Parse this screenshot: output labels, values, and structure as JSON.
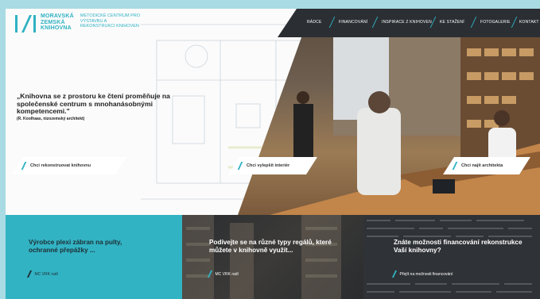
{
  "logo": {
    "name_lines": [
      "MORAVSKÁ",
      "ZEMSKÁ",
      "KNIHOVNA"
    ],
    "subtitle_lines": [
      "METODICKÉ CENTRUM PRO",
      "VÝSTAVBU A",
      "REKONSTRUKCI KNIHOVEN"
    ]
  },
  "nav": {
    "items": [
      "RÁDCE",
      "FINANCOVÁNÍ",
      "INSPIRACE Z KNIHOVEN",
      "KE STAŽENÍ",
      "FOTOGALERIE",
      "KONTAKT"
    ]
  },
  "hero": {
    "quote": "„Knihovna se z prostoru ke čtení proměňuje na společenské centrum s mnohanásobnými kompetencemi.\"",
    "author": "(R. Koolhaas, nizozemský architekt)",
    "buttons": [
      "Chci rekonstruovat knihovnu",
      "Chci vylepšit interiér",
      "Chci najít architekta"
    ]
  },
  "tiles": [
    {
      "title": "Výrobce plexi zábran na pulty, ochranné přepážky ...",
      "link": "MC VRK radí"
    },
    {
      "title": "Podívejte se na různé typy regálů, které můžete v knihovně využít...",
      "link": "MC VRK radí"
    },
    {
      "title": "Znáte možnosti financování rekonstrukce Vaší knihovny?",
      "link": "Přejít na možnosti financování"
    }
  ],
  "colors": {
    "accent": "#2fb2c3",
    "nav_bg": "#2b2f33",
    "tile_teal": "#32b3c4",
    "page_bg": "#a8dbe3"
  }
}
